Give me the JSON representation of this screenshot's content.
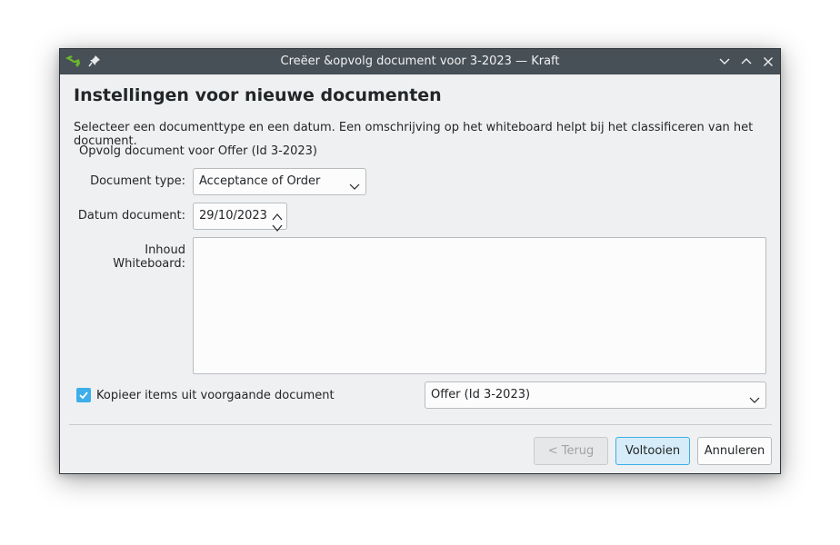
{
  "window": {
    "title": "Creëer &opvolg document voor 3-2023 — Kraft",
    "icons": {
      "app": "kraft-app-icon",
      "pin": "pin-icon",
      "minimize": "minimize-icon",
      "maximize": "maximize-icon",
      "close": "close-icon"
    }
  },
  "dialog": {
    "heading": "Instellingen voor nieuwe documenten",
    "description": "Selecteer een documenttype en een datum. Een omschrijving op het whiteboard helpt bij het classificeren van het document.",
    "subtitle": "Opvolg document voor Offer (Id 3-2023)"
  },
  "form": {
    "doc_type_label": "Document type:",
    "doc_type_value": "Acceptance of Order",
    "date_label": "Datum document:",
    "date_value": "29/10/2023",
    "whiteboard_label": "Inhoud Whiteboard:",
    "whiteboard_value": "",
    "copy_items_label": "Kopieer items uit voorgaande document",
    "copy_items_checked": true,
    "prev_doc_value": "Offer (Id 3-2023)"
  },
  "buttons": {
    "back": "< Terug",
    "finish": "Voltooien",
    "cancel": "Annuleren"
  },
  "colors": {
    "accent": "#3daee9",
    "titlebar": "#475057",
    "window_bg": "#eff0f1"
  }
}
